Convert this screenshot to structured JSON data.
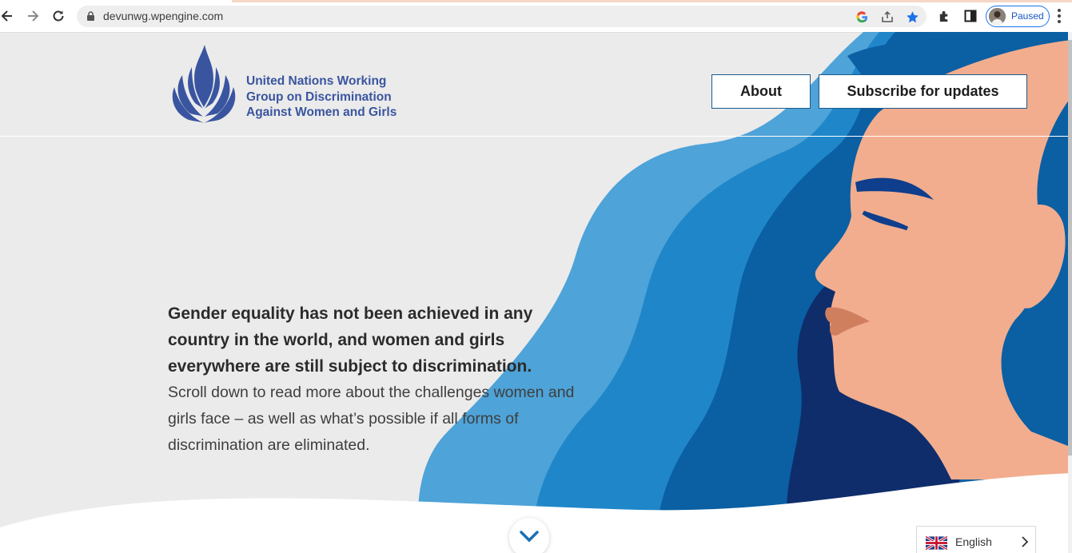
{
  "browser": {
    "url": "devunwg.wpengine.com",
    "profile_label": "Paused"
  },
  "site": {
    "logo_text": "United Nations Working Group on Discrimination Against Women and Girls",
    "nav": {
      "about_label": "About",
      "subscribe_label": "Subscribe for updates"
    }
  },
  "hero": {
    "headline": "Gender equality has not been achieved in any country in the world, and women and girls everywhere are still subject to discrimination.",
    "body": "Scroll down to read more about the challenges women and girls face – as well as what’s possible if all forms of discrimination are eliminated."
  },
  "language_switcher": {
    "label": "English"
  },
  "colors": {
    "background": "#ebebeb",
    "hair_light": "#4ea3d8",
    "hair_mid": "#1f87c9",
    "hair_dark": "#0b5fa3",
    "hair_navy": "#0f2d6b",
    "skin": "#f2ad8e",
    "lips": "#d07f5e",
    "brand_text": "#3a55a0"
  },
  "icons": [
    "back-icon",
    "forward-icon",
    "reload-icon",
    "lock-icon",
    "google-icon",
    "share-icon",
    "star-icon",
    "extensions-icon",
    "sidepanel-icon",
    "menu-icon",
    "chevron-down-icon",
    "uk-flag-icon",
    "chevron-right-icon"
  ]
}
